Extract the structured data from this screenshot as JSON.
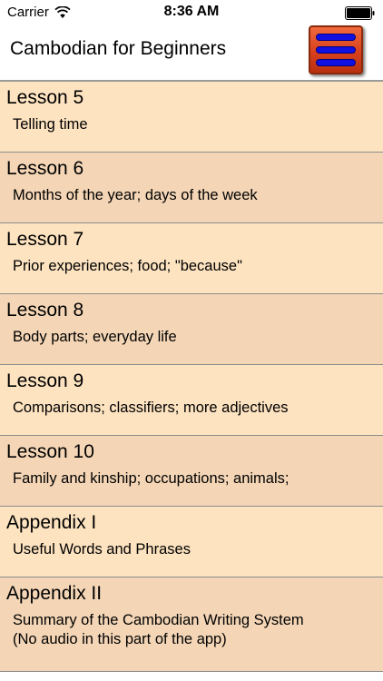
{
  "status_bar": {
    "carrier": "Carrier",
    "time": "8:36 AM"
  },
  "nav": {
    "title": "Cambodian for Beginners"
  },
  "colors": {
    "row_light": "#fde3c0",
    "row_dark": "#f4d6b6",
    "menu_button": "#d8401d",
    "menu_bars": "#1010e0"
  },
  "lessons": [
    {
      "title": "Lesson 5",
      "desc": [
        "Telling time"
      ]
    },
    {
      "title": "Lesson 6",
      "desc": [
        "Months of the year; days of the week"
      ]
    },
    {
      "title": "Lesson 7",
      "desc": [
        "Prior experiences; food; \"because\""
      ]
    },
    {
      "title": "Lesson 8",
      "desc": [
        "Body parts; everyday life"
      ]
    },
    {
      "title": "Lesson 9",
      "desc": [
        "Comparisons; classifiers; more adjectives"
      ]
    },
    {
      "title": "Lesson 10",
      "desc": [
        "Family and kinship; occupations; animals;"
      ]
    },
    {
      "title": "Appendix I",
      "desc": [
        "Useful Words and Phrases"
      ]
    },
    {
      "title": "Appendix II",
      "desc": [
        "Summary of the Cambodian Writing System",
        "(No audio in this part of the app)"
      ]
    }
  ]
}
